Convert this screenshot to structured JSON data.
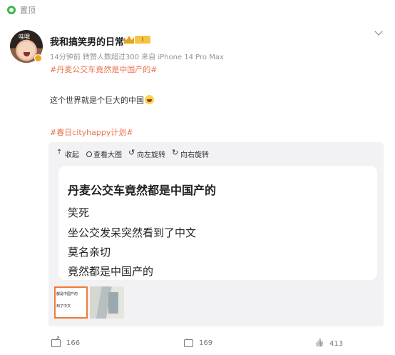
{
  "pin": {
    "label": "置顶"
  },
  "author": {
    "name": "我和搞笑男的日常",
    "avatar_text": "哇哦",
    "level": "I",
    "meta": "14分钟前 转赞人数超过300  来自 iPhone 14 Pro Max"
  },
  "post": {
    "topic1": "#丹麦公交车竟然是中国产的#",
    "body": "这个世界就是个巨大的中国",
    "topic2": "#春日cityhappy计划#"
  },
  "media": {
    "toolbar": {
      "collapse": "收起",
      "zoom": "查看大图",
      "rotate_left": "向左旋转",
      "rotate_right": "向右旋转"
    },
    "image": {
      "title": "丹麦公交车竟然都是中国产的",
      "lines": [
        "笑死",
        "坐公交发呆突然看到了中文",
        "莫名亲切",
        "竟然都是中国产的"
      ]
    },
    "thumb1": {
      "line1": "都是中国产的",
      "line2": "到了中文"
    }
  },
  "actions": {
    "repost": "166",
    "comment": "169",
    "like": "413"
  },
  "colors": {
    "topic": "#eb7350",
    "pin": "#3fb64a",
    "badge": "#f7a21b"
  }
}
